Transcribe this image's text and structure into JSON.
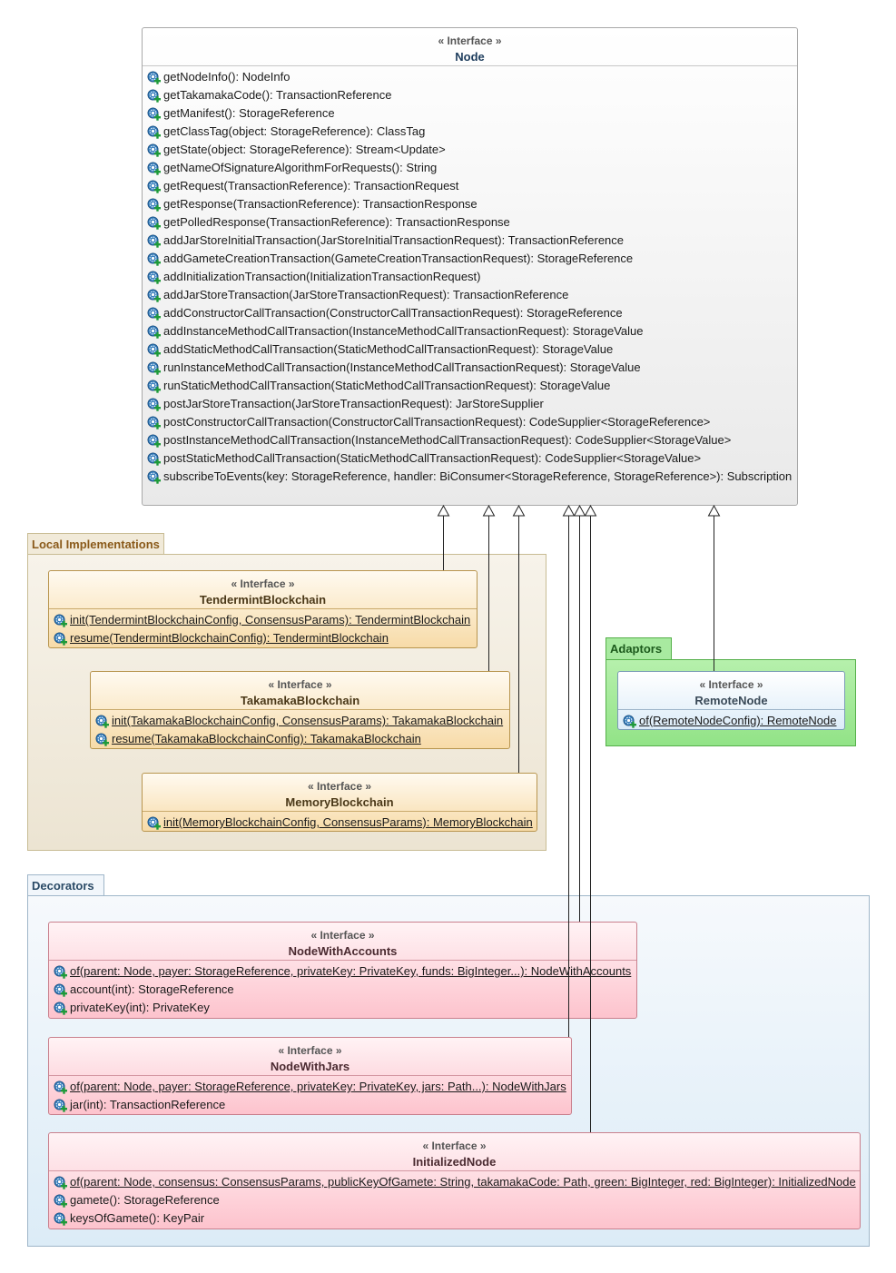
{
  "packages": {
    "local_implementations": "Local Implementations",
    "adaptors": "Adaptors",
    "decorators": "Decorators"
  },
  "stereotype": "« Interface »",
  "icons": {
    "method": "method-gear-plus-icon"
  },
  "colors": {
    "node_border": "#a8a8a8",
    "local_pkg": "#f1ead9",
    "adaptors_pkg": "#a8eaa0",
    "decorators_pkg": "#dcecf7",
    "tan_class": "#f7dba8",
    "pink_class": "#fdc3cd",
    "blue_class": "#dcecf8"
  },
  "node": {
    "name": "Node",
    "methods": [
      "getNodeInfo(): NodeInfo",
      "getTakamakaCode(): TransactionReference",
      "getManifest(): StorageReference",
      "getClassTag(object: StorageReference): ClassTag",
      "getState(object: StorageReference): Stream<Update>",
      "getNameOfSignatureAlgorithmForRequests(): String",
      "getRequest(TransactionReference): TransactionRequest",
      "getResponse(TransactionReference): TransactionResponse",
      "getPolledResponse(TransactionReference): TransactionResponse",
      "addJarStoreInitialTransaction(JarStoreInitialTransactionRequest): TransactionReference",
      "addGameteCreationTransaction(GameteCreationTransactionRequest): StorageReference",
      "addInitializationTransaction(InitializationTransactionRequest)",
      "addJarStoreTransaction(JarStoreTransactionRequest): TransactionReference",
      "addConstructorCallTransaction(ConstructorCallTransactionRequest): StorageReference",
      "addInstanceMethodCallTransaction(InstanceMethodCallTransactionRequest): StorageValue",
      "addStaticMethodCallTransaction(StaticMethodCallTransactionRequest): StorageValue",
      "runInstanceMethodCallTransaction(InstanceMethodCallTransactionRequest): StorageValue",
      "runStaticMethodCallTransaction(StaticMethodCallTransactionRequest): StorageValue",
      "postJarStoreTransaction(JarStoreTransactionRequest): JarStoreSupplier",
      "postConstructorCallTransaction(ConstructorCallTransactionRequest): CodeSupplier<StorageReference>",
      "postInstanceMethodCallTransaction(InstanceMethodCallTransactionRequest): CodeSupplier<StorageValue>",
      "postStaticMethodCallTransaction(StaticMethodCallTransactionRequest): CodeSupplier<StorageValue>",
      "subscribeToEvents(key: StorageReference, handler: BiConsumer<StorageReference, StorageReference>): Subscription"
    ]
  },
  "tendermint": {
    "name": "TendermintBlockchain",
    "methods": [
      "init(TendermintBlockchainConfig, ConsensusParams): TendermintBlockchain",
      "resume(TendermintBlockchainConfig): TendermintBlockchain"
    ]
  },
  "takamaka": {
    "name": "TakamakaBlockchain",
    "methods": [
      "init(TakamakaBlockchainConfig, ConsensusParams): TakamakaBlockchain",
      "resume(TakamakaBlockchainConfig): TakamakaBlockchain"
    ]
  },
  "memory": {
    "name": "MemoryBlockchain",
    "methods": [
      "init(MemoryBlockchainConfig, ConsensusParams): MemoryBlockchain"
    ]
  },
  "remote": {
    "name": "RemoteNode",
    "methods": [
      "of(RemoteNodeConfig): RemoteNode"
    ]
  },
  "accounts": {
    "name": "NodeWithAccounts",
    "methods": [
      "of(parent: Node, payer: StorageReference, privateKey: PrivateKey, funds: BigInteger...): NodeWithAccounts",
      "account(int): StorageReference",
      "privateKey(int): PrivateKey"
    ]
  },
  "jars": {
    "name": "NodeWithJars",
    "methods": [
      "of(parent: Node, payer: StorageReference, privateKey: PrivateKey, jars: Path...): NodeWithJars",
      "jar(int): TransactionReference"
    ]
  },
  "initialized": {
    "name": "InitializedNode",
    "methods": [
      "of(parent: Node, consensus: ConsensusParams, publicKeyOfGamete: String, takamakaCode: Path, green: BigInteger, red: BigInteger): InitializedNode",
      "gamete(): StorageReference",
      "keysOfGamete(): KeyPair"
    ]
  }
}
